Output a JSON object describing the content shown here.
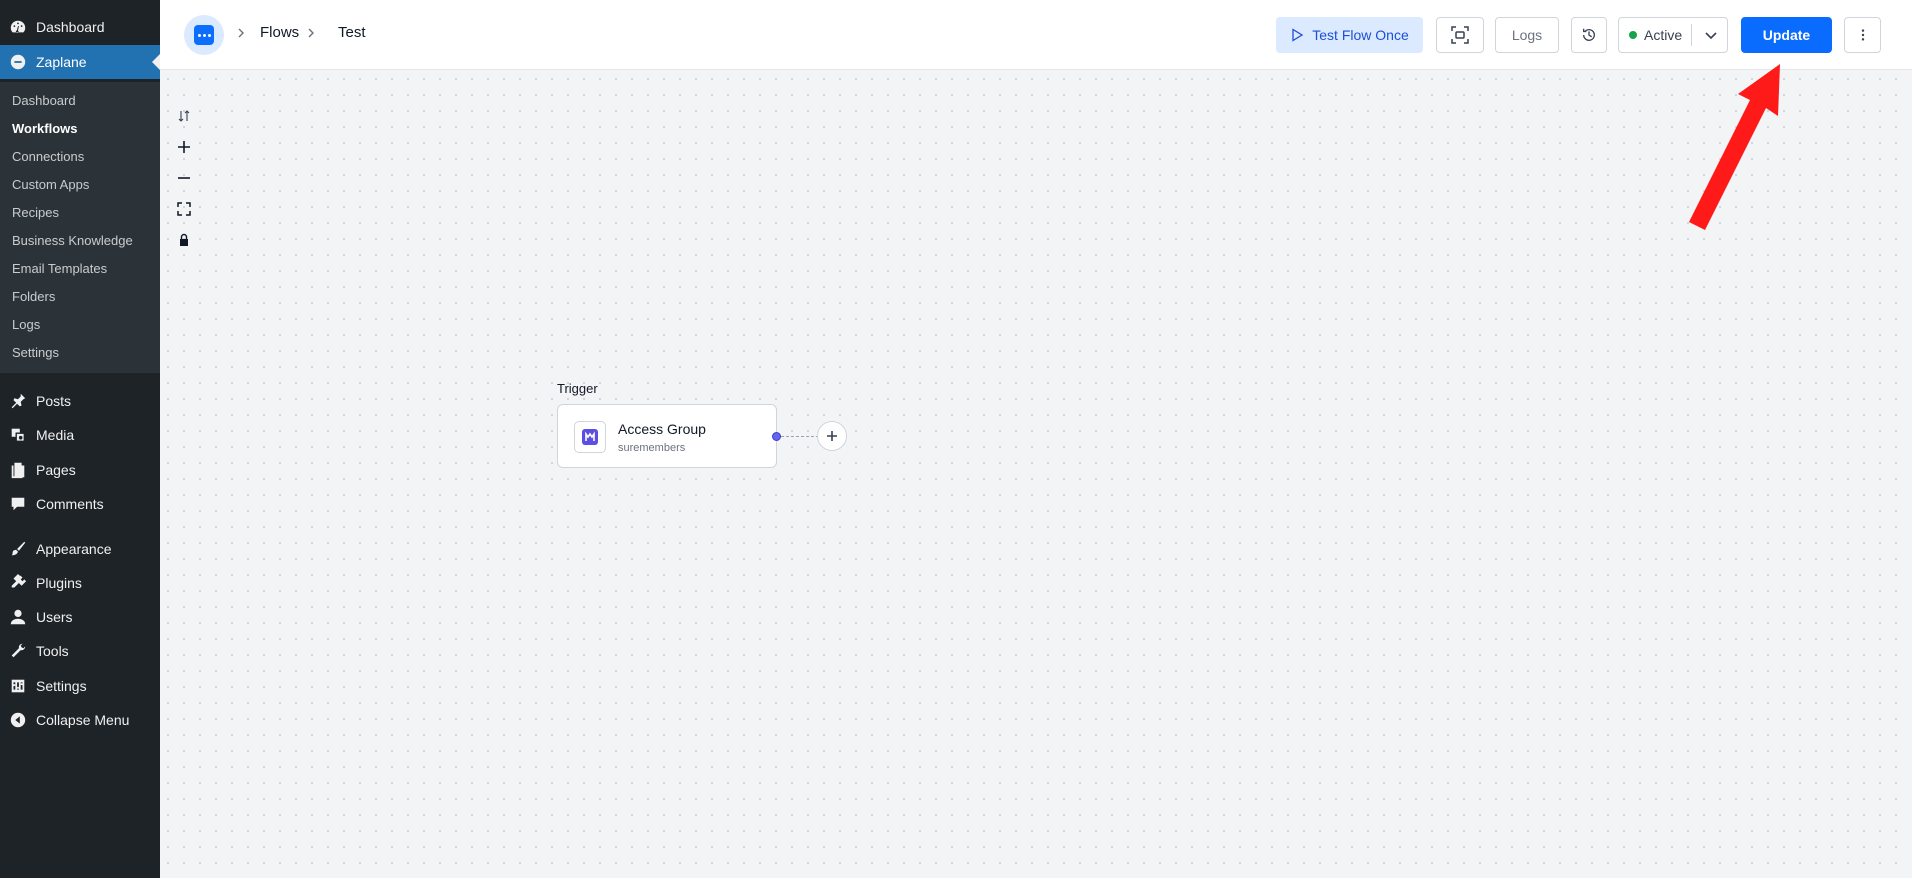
{
  "sidebar": {
    "top_items": [
      {
        "label": "Dashboard",
        "icon": "dashboard-icon"
      },
      {
        "label": "Zaplane",
        "icon": "zaplane-icon"
      }
    ],
    "submenu": [
      "Dashboard",
      "Workflows",
      "Connections",
      "Custom Apps",
      "Recipes",
      "Business Knowledge",
      "Email Templates",
      "Folders",
      "Logs",
      "Settings"
    ],
    "active_submenu": "Workflows",
    "menu": [
      {
        "label": "Posts",
        "icon": "pin-icon"
      },
      {
        "label": "Media",
        "icon": "media-icon"
      },
      {
        "label": "Pages",
        "icon": "pages-icon"
      },
      {
        "label": "Comments",
        "icon": "comment-icon"
      },
      {
        "label": "Appearance",
        "icon": "paintbrush-icon"
      },
      {
        "label": "Plugins",
        "icon": "plugin-icon"
      },
      {
        "label": "Users",
        "icon": "user-icon"
      },
      {
        "label": "Tools",
        "icon": "wrench-icon"
      },
      {
        "label": "Settings",
        "icon": "settings-icon"
      },
      {
        "label": "Collapse Menu",
        "icon": "collapse-icon"
      }
    ]
  },
  "header": {
    "breadcrumb": [
      "Flows",
      "Test"
    ],
    "test_button": "Test Flow Once",
    "logs_button": "Logs",
    "status": "Active",
    "update_button": "Update"
  },
  "canvas": {
    "trigger_label": "Trigger",
    "node": {
      "title": "Access Group",
      "subtitle": "suremembers",
      "icon": "suremembers-icon"
    }
  },
  "colors": {
    "sidebar_bg": "#1d2327",
    "submenu_bg": "#2c3338",
    "active_menu": "#2271b1",
    "primary": "#0a6cff",
    "status_dot": "#16a34a",
    "annotation_arrow": "#ff1a1a"
  }
}
